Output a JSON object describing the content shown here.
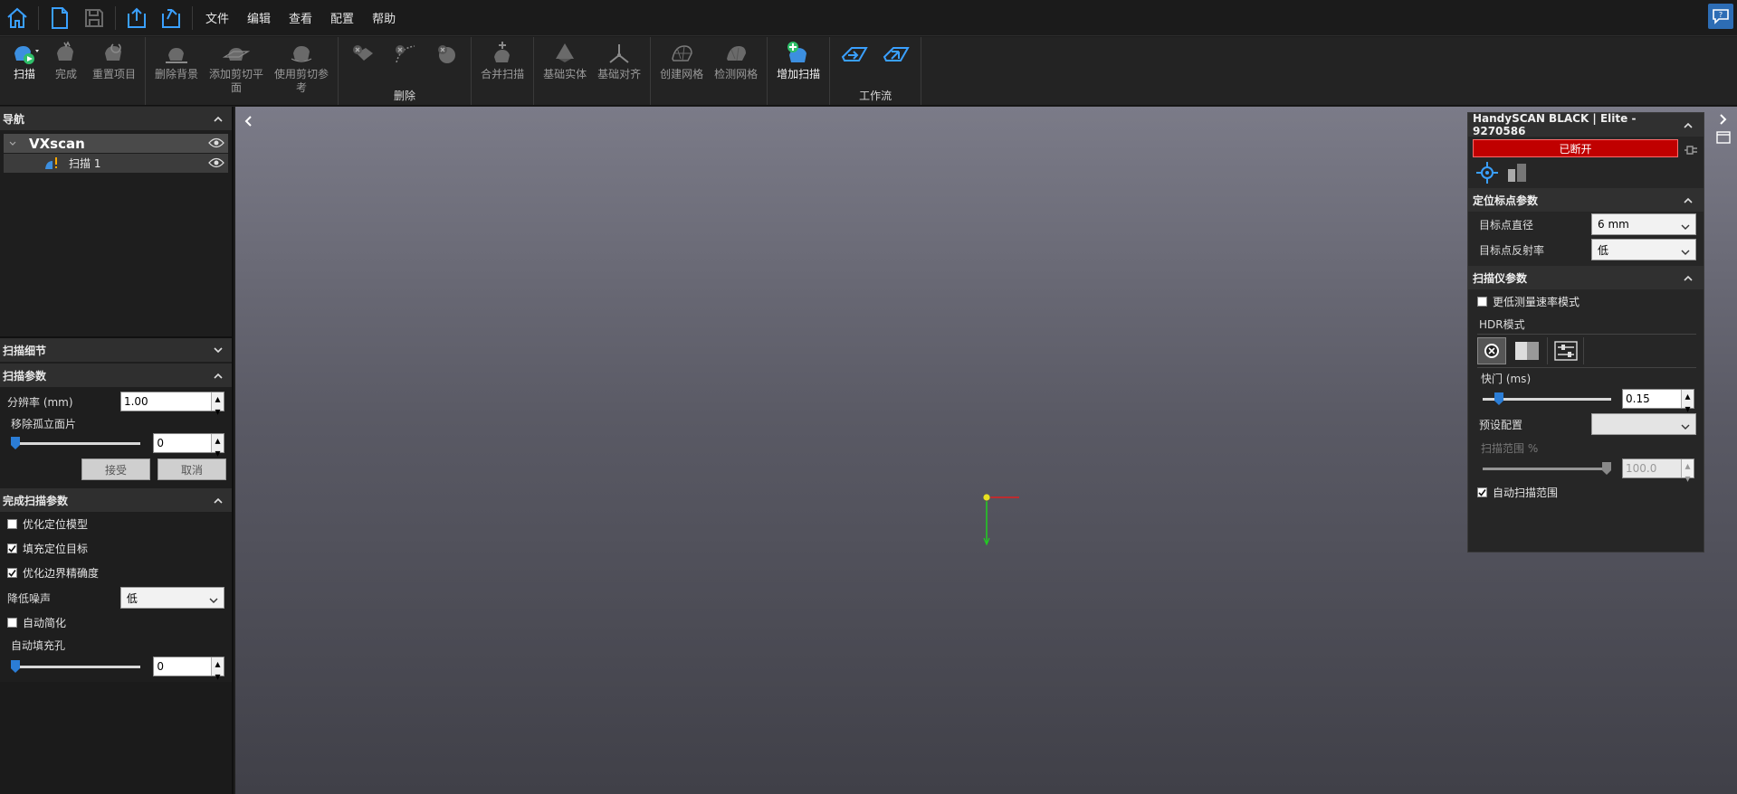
{
  "menu": {
    "items": [
      "文件",
      "编辑",
      "查看",
      "配置",
      "帮助"
    ]
  },
  "ribbon": {
    "scan": "扫描",
    "finish": "完成",
    "reset": "重置项目",
    "remove_bg": "删除背景",
    "add_clip_1": "添加剪切平",
    "add_clip_2": "面",
    "use_clip_1": "使用剪切参",
    "use_clip_2": "考",
    "delete_group": "删除",
    "merge": "合并扫描",
    "base_entity": "基础实体",
    "base_align": "基础对齐",
    "create_mesh": "创建网格",
    "inspect_mesh": "检测网格",
    "add_scan": "增加扫描",
    "workflow_group": "工作流"
  },
  "left": {
    "nav_title": "导航",
    "tree_root": "VXscan",
    "tree_child": "扫描 1",
    "scan_detail_title": "扫描细节",
    "scan_params_title": "扫描参数",
    "resolution_label": "分辨率 (mm)",
    "resolution_value": "1.00",
    "isolated_label": "移除孤立面片",
    "isolated_value": "0",
    "isolated_level": 0,
    "accept": "接受",
    "cancel": "取消",
    "finish_params_title": "完成扫描参数",
    "opt_positioning": "优化定位模型",
    "fill_targets": "填充定位目标",
    "opt_border": "优化边界精确度",
    "noise_label": "降低噪声",
    "noise_value": "低",
    "auto_simplify": "自动简化",
    "auto_fill_label": "自动填充孔",
    "auto_fill_value": "0",
    "auto_fill_level": 0
  },
  "right": {
    "device_title": "HandySCAN BLACK | Elite - 9270586",
    "status": "已断开",
    "target_params_title": "定位标点参数",
    "target_diameter_label": "目标点直径",
    "target_diameter_value": "6 mm",
    "target_reflect_label": "目标点反射率",
    "target_reflect_value": "低",
    "scanner_params_title": "扫描仪参数",
    "low_rate_mode": "更低测量速率模式",
    "hdr_label": "HDR模式",
    "shutter_label": "快门 (ms)",
    "shutter_value": "0.15",
    "shutter_level": 0.1,
    "preset_label": "预设配置",
    "preset_value": "",
    "scan_range_label": "扫描范围 %",
    "scan_range_value": "100.0",
    "scan_range_level": 1.0,
    "auto_range": "自动扫描范围"
  },
  "colors": {
    "accent_blue": "#2b7dd6",
    "status_red": "#c00000"
  }
}
